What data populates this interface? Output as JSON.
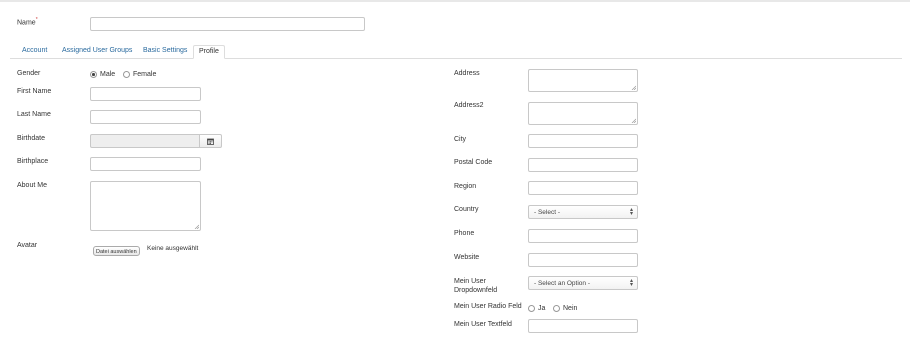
{
  "name_field": {
    "label": "Name",
    "required_mark": "*",
    "value": ""
  },
  "tabs": [
    {
      "label": "Account"
    },
    {
      "label": "Assigned User Groups"
    },
    {
      "label": "Basic Settings"
    },
    {
      "label": "Profile",
      "active": true
    }
  ],
  "left": {
    "gender": {
      "label": "Gender",
      "options": [
        "Male",
        "Female"
      ],
      "selected": "Male"
    },
    "first_name": {
      "label": "First Name",
      "value": ""
    },
    "last_name": {
      "label": "Last Name",
      "value": ""
    },
    "birthdate": {
      "label": "Birthdate",
      "value": "",
      "icon": "calendar-icon"
    },
    "birthplace": {
      "label": "Birthplace",
      "value": ""
    },
    "about_me": {
      "label": "About Me",
      "value": ""
    },
    "avatar": {
      "label": "Avatar",
      "button": "Datei auswählen",
      "status": "Keine ausgewählt"
    }
  },
  "right": {
    "address": {
      "label": "Address",
      "value": ""
    },
    "address2": {
      "label": "Address2",
      "value": ""
    },
    "city": {
      "label": "City",
      "value": ""
    },
    "postal_code": {
      "label": "Postal Code",
      "value": ""
    },
    "region": {
      "label": "Region",
      "value": ""
    },
    "country": {
      "label": "Country",
      "selected": "- Select -"
    },
    "phone": {
      "label": "Phone",
      "value": ""
    },
    "website": {
      "label": "Website",
      "value": ""
    },
    "dropdown": {
      "label_line1": "Mein User",
      "label_line2": "Dropdownfeld",
      "selected": "- Select an Option -"
    },
    "radio_field": {
      "label": "Mein User Radio Feld",
      "options": [
        "Ja",
        "Nein"
      ],
      "selected": ""
    },
    "textfield": {
      "label": "Mein User Textfeld",
      "value": ""
    }
  }
}
